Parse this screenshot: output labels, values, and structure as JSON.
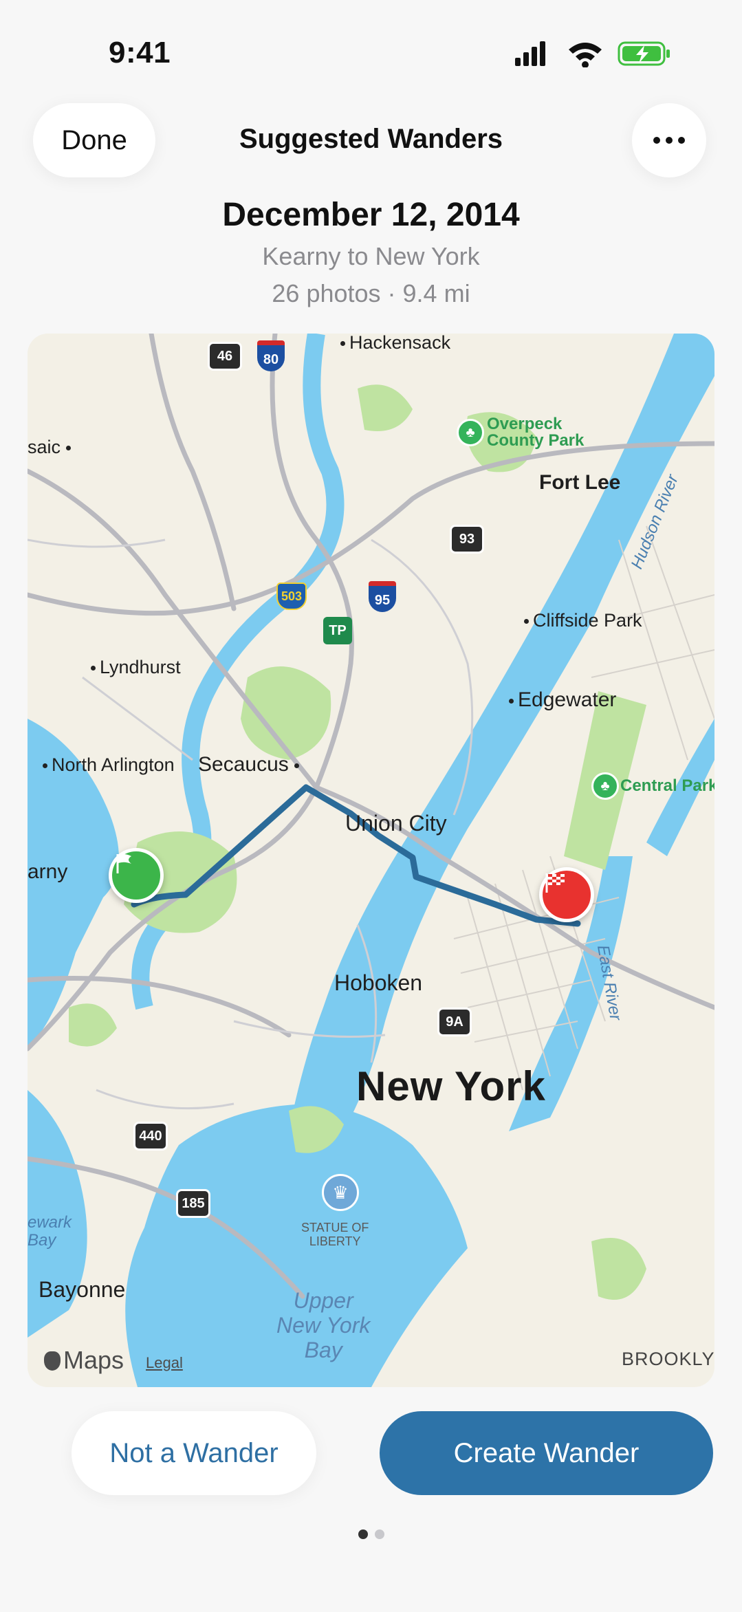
{
  "status_bar": {
    "time": "9:41"
  },
  "nav": {
    "done_label": "Done",
    "title": "Suggested Wanders"
  },
  "wander": {
    "date": "December 12, 2014",
    "route": "Kearny to New York",
    "meta": "26 photos · 9.4 mi"
  },
  "map": {
    "labels": {
      "hackensack": "Hackensack",
      "passaic": "saic",
      "overpeck": "Overpeck",
      "overpeck2": "County Park",
      "fort_lee": "Fort Lee",
      "hudson_river": "Hudson River",
      "cliffside_park": "Cliffside Park",
      "lyndhurst": "Lyndhurst",
      "edgewater": "Edgewater",
      "north_arlington": "North Arlington",
      "secaucus": "Secaucus",
      "central_park": "Central Park",
      "union_city": "Union City",
      "kearny": "arny",
      "hoboken": "Hoboken",
      "east_river": "East River",
      "new_york": "New York",
      "newark_bay1": "ewark",
      "newark_bay2": "Bay",
      "statue1": "STATUE OF",
      "statue2": "LIBERTY",
      "bayonne": "Bayonne",
      "upper_bay1": "Upper",
      "upper_bay2": "New York",
      "upper_bay3": "Bay",
      "brooklyn": "BROOKLYN"
    },
    "shields": {
      "r46": "46",
      "i80": "80",
      "r93": "93",
      "c503": "503",
      "i95": "95",
      "tp": "TP",
      "r9a": "9A",
      "r440": "440",
      "r185": "185"
    },
    "brand": "Maps",
    "legal": "Legal",
    "colors": {
      "route": "#2b6b99",
      "water": "#7ccbf0",
      "land": "#f3f0e6",
      "park": "#bfe3a1"
    }
  },
  "actions": {
    "not_label": "Not a Wander",
    "create_label": "Create Wander"
  },
  "pager": {
    "pages": 2,
    "current": 1
  }
}
